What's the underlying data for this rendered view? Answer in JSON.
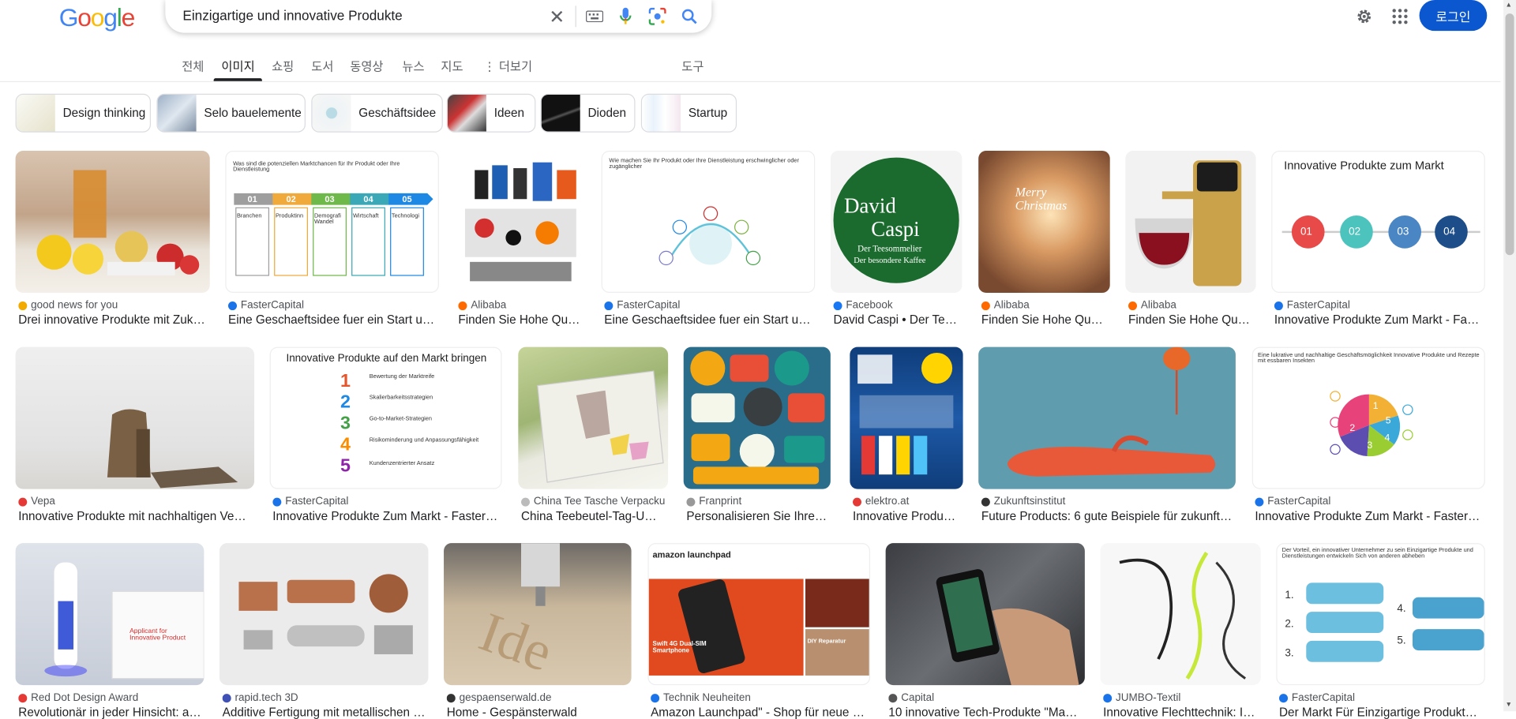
{
  "header": {
    "logo_letters": [
      {
        "ch": "G",
        "color": "#4285F4"
      },
      {
        "ch": "o",
        "color": "#EA4335"
      },
      {
        "ch": "o",
        "color": "#FBBC05"
      },
      {
        "ch": "g",
        "color": "#4285F4"
      },
      {
        "ch": "l",
        "color": "#34A853"
      },
      {
        "ch": "e",
        "color": "#EA4335"
      }
    ],
    "search_query": "Einzigartige und innovative Produkte",
    "login_label": "로그인"
  },
  "tabs": {
    "all": "전체",
    "images": "이미지",
    "shopping": "쇼핑",
    "books": "도서",
    "videos": "동영상",
    "news": "뉴스",
    "maps": "지도",
    "more": "더보기",
    "tools": "도구"
  },
  "chips": [
    "Design thinking",
    "Selo bauelemente",
    "Geschäftsidee",
    "Ideen",
    "Dioden",
    "Startup"
  ],
  "row1": [
    {
      "source": "good news for you",
      "title": "Drei innovative Produkte mit Zuku...",
      "fav": "#f2a900"
    },
    {
      "source": "FasterCapital",
      "title": "Eine Geschaeftsidee fuer ein Start up ...",
      "fav": "#1a73e8"
    },
    {
      "source": "Alibaba",
      "title": "Finden Sie Hohe Qual...",
      "fav": "#ff6a00"
    },
    {
      "source": "FasterCapital",
      "title": "Eine Geschaeftsidee fuer ein Start up ...",
      "fav": "#1a73e8"
    },
    {
      "source": "Facebook",
      "title": "David Caspi • Der Tee...",
      "fav": "#1877f2"
    },
    {
      "source": "Alibaba",
      "title": "Finden Sie Hohe Qual...",
      "fav": "#ff6a00"
    },
    {
      "source": "Alibaba",
      "title": "Finden Sie Hohe Qual...",
      "fav": "#ff6a00"
    },
    {
      "source": "FasterCapital",
      "title": "Innovative Produkte Zum Markt - Fast...",
      "fav": "#1a73e8"
    }
  ],
  "row2": [
    {
      "source": "Vepa",
      "title": "Innovative Produkte mit nachhaltigen Vepa-...",
      "fav": "#e53935"
    },
    {
      "source": "FasterCapital",
      "title": "Innovative Produkte Zum Markt - FasterCa...",
      "fav": "#1a73e8"
    },
    {
      "source": "China Tee Tasche Verpacku...",
      "title": "China Teebeutel-Tag-Ums...",
      "fav": "#bbb"
    },
    {
      "source": "Franprint",
      "title": "Personalisieren Sie Ihre P...",
      "fav": "#999"
    },
    {
      "source": "elektro.at",
      "title": "Innovative Produkt...",
      "fav": "#e53935"
    },
    {
      "source": "Zukunftsinstitut",
      "title": "Future Products: 6 gute Beispiele für zukunftsf...",
      "fav": "#333"
    },
    {
      "source": "FasterCapital",
      "title": "Innovative Produkte Zum Markt - FasterCa...",
      "fav": "#1a73e8"
    }
  ],
  "row3": [
    {
      "source": "Red Dot Design Award",
      "title": "Revolutionär in jeder Hinsicht: am ...",
      "fav": "#e53935"
    },
    {
      "source": "rapid.tech 3D",
      "title": "Additive Fertigung mit metallischen M...",
      "fav": "#3f51b5"
    },
    {
      "source": "gespaenserwald.de",
      "title": "Home - Gespänsterwald",
      "fav": "#333"
    },
    {
      "source": "Technik Neuheiten",
      "title": "Amazon Launchpad\" - Shop für neue in...",
      "fav": "#1a73e8"
    },
    {
      "source": "Capital",
      "title": "10 innovative Tech-Produkte \"Made ...",
      "fav": "#555"
    },
    {
      "source": "JUMBO-Textil",
      "title": "Innovative Flechttechnik: In...",
      "fav": "#1a73e8"
    },
    {
      "source": "FasterCapital",
      "title": "Der Markt Für Einzigartige Produkte ...",
      "fav": "#1a73e8"
    }
  ],
  "image_text": {
    "fc1_heading": "Was sind die potenziellen Marktchancen für Ihr Produkt oder Ihre Dienstleistung",
    "fc1_steps": [
      "01",
      "02",
      "03",
      "04",
      "05"
    ],
    "fc1_labels": [
      "Branchen",
      "Produktinn",
      "Demografi Wandel",
      "Wirtschaft",
      "Technologi"
    ],
    "fc2_heading": "Wie machen Sie Ihr Produkt oder Ihre Dienstleistung erschwinglicher oder zugänglicher",
    "dc_line1": "David",
    "dc_line2": "Caspi",
    "dc_line3": "Der Teesommelier",
    "dc_line4": "Der besondere Kaffee",
    "merry": "Merry Christmas",
    "fc3_heading": "Innovative Produkte zum Markt",
    "fc3_steps": [
      "01",
      "02",
      "03",
      "04"
    ],
    "fc4_heading": "Innovative Produkte auf den Markt bringen",
    "fc4_items": [
      "Bewertung der Marktreife",
      "Skalierbarkeitsstrategien",
      "Go-to-Market-Strategien",
      "Risikominderung und Anpassungsfähigkeit",
      "Kundenzentrierter Ansatz"
    ],
    "fc4_nums": [
      "1",
      "2",
      "3",
      "4",
      "5"
    ],
    "fc5_heading": "Eine lukrative und nachhaltige Geschäftsmöglichkeit Innovative Produkte und Rezepte mit essbaren Insekten",
    "pie_nums": [
      "1",
      "5",
      "2",
      "4",
      "3"
    ],
    "reddot": "Applicant for Innovative Product",
    "amazon": "amazon launchpad",
    "phone": "Swift 4G Dual-SIM Smartphone",
    "diy": "DIY Reparatur",
    "fc6_heading": "Der Vorteil, ein innovativer Unternehmer zu sein Einzigartige Produkte und Dienstleistungen entwickeln Sich von anderen abheben"
  },
  "colors": {
    "accent": "#0b57d0",
    "text": "#202124",
    "muted": "#5f6368"
  }
}
